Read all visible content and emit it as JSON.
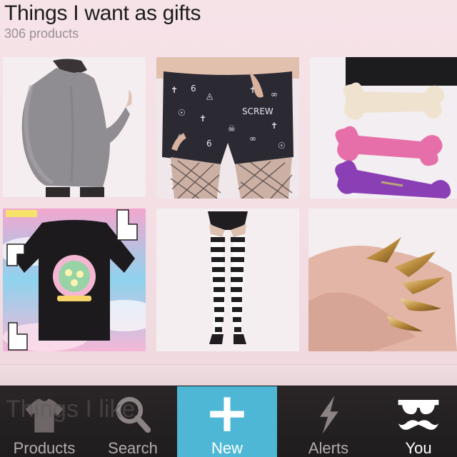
{
  "header": {
    "title": "Things I want as gifts",
    "count": "306 products"
  },
  "products": [
    {
      "name": "grey-batwing-sweater"
    },
    {
      "name": "occult-print-shorts"
    },
    {
      "name": "fuzzy-bone-hairclips"
    },
    {
      "name": "black-kawaii-sweatshirt"
    },
    {
      "name": "striped-thigh-high-stockings"
    },
    {
      "name": "gold-claw-rings"
    }
  ],
  "ghost_text": "Things I like",
  "tabbar": {
    "tabs": [
      {
        "label": "Products",
        "icon": "tshirt-icon"
      },
      {
        "label": "Search",
        "icon": "search-icon"
      },
      {
        "label": "New",
        "icon": "plus-icon",
        "active": true
      },
      {
        "label": "Alerts",
        "icon": "lightning-icon"
      },
      {
        "label": "You",
        "icon": "sunglasses-mustache-icon"
      }
    ]
  },
  "colors": {
    "active_tab": "#4eb7d6",
    "tabbar_bg": "#231f20",
    "page_bg": "#f4e1e6"
  }
}
